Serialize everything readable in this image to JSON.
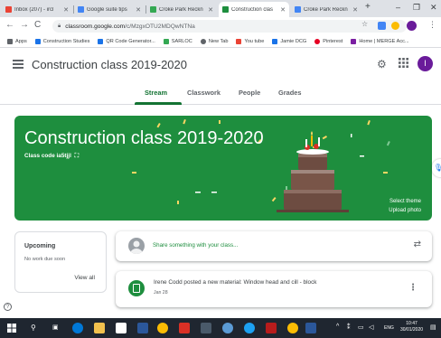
{
  "browser": {
    "tabs": [
      {
        "label": "Inbox (207) - ircl",
        "color": "#ea4335"
      },
      {
        "label": "Google suite tips",
        "color": "#4285f4"
      },
      {
        "label": "Croke Park Reckn",
        "color": "#34a853"
      },
      {
        "label": "Construction clas",
        "color": "#1e8e3e"
      },
      {
        "label": "Croke Park Reckn",
        "color": "#4285f4"
      }
    ],
    "new_tab": "+",
    "url_host": "classroom.google.com",
    "url_path": "/c/MzgxOTU2MDQwNTNa",
    "bookmarks": [
      {
        "label": "Apps",
        "color": "#5f6368"
      },
      {
        "label": "Construction Studies",
        "color": "#1a73e8"
      },
      {
        "label": "QR Code Generator...",
        "color": "#1a73e8"
      },
      {
        "label": "SARLOC",
        "color": "#34a853"
      },
      {
        "label": "New Tab",
        "color": "#5f6368"
      },
      {
        "label": "You tube",
        "color": "#ea4335"
      },
      {
        "label": "Jamie DCG",
        "color": "#1a73e8"
      },
      {
        "label": "Pinterest",
        "color": "#e60023"
      },
      {
        "label": "Home | MERGE Acc...",
        "color": "#7b1fa2"
      }
    ]
  },
  "header": {
    "title": "Construction class 2019-2020",
    "avatar_letter": "I"
  },
  "tabs": {
    "stream": "Stream",
    "classwork": "Classwork",
    "people": "People",
    "grades": "Grades"
  },
  "banner": {
    "title": "Construction class 2019-2020",
    "class_code": "Class code  ia5tjjl",
    "select_theme": "Select theme",
    "upload_photo": "Upload photo",
    "color": "#1e8e3e"
  },
  "upcoming": {
    "title": "Upcoming",
    "empty": "No work due soon",
    "view_all": "View all"
  },
  "share": {
    "placeholder": "Share something with your class..."
  },
  "post": {
    "text": "Irene Codd posted a new material: Window head and cill - block",
    "date": "Jan 28"
  },
  "taskbar": {
    "lang": "ENG",
    "time": "10:47",
    "date": "30/01/2020"
  }
}
